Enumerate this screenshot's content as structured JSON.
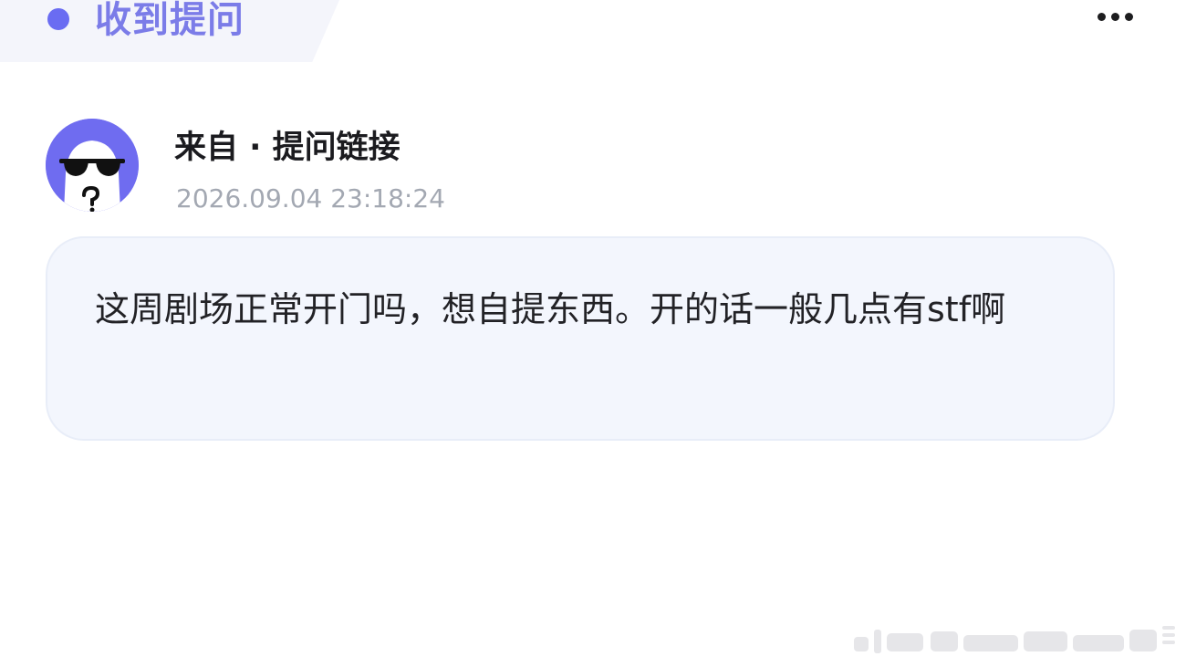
{
  "header": {
    "title": "收到提问",
    "more_icon": "more-horizontal-icon",
    "accent_color": "#6a6cf2"
  },
  "sender": {
    "avatar_icon": "anonymous-sunglasses-avatar-icon",
    "avatar_color": "#6f6cf0",
    "label": "来自 · 提问链接",
    "timestamp": "2026.09.04 23:18:24"
  },
  "question": {
    "text": "这周剧场正常开门吗，想自提东西。开的话一般几点有stf啊"
  }
}
